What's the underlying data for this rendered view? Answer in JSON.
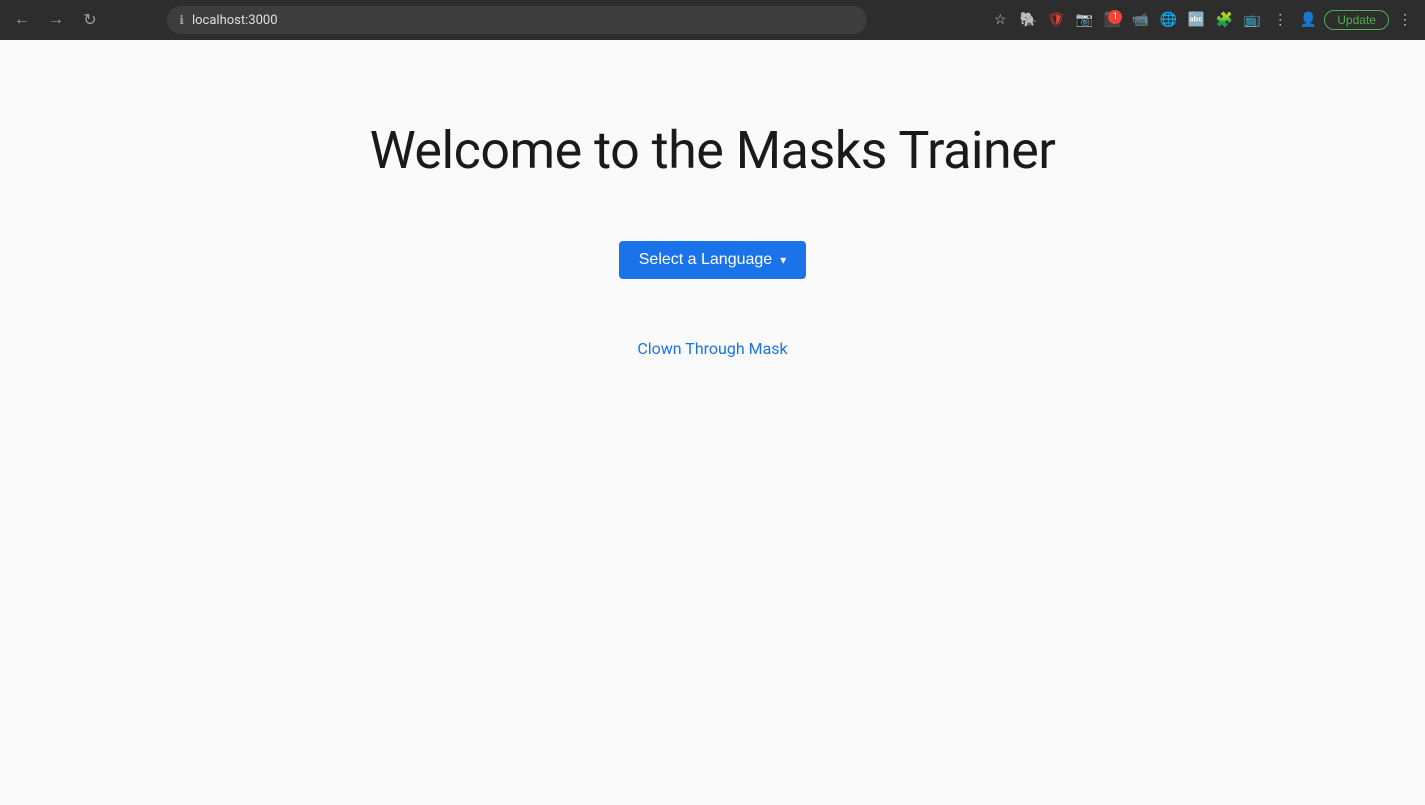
{
  "browser": {
    "url": "localhost:3000",
    "update_label": "Update"
  },
  "page": {
    "title": "Welcome to the Masks Trainer",
    "select_language_label": "Select a Language",
    "clown_link_label": "Clown Through Mask"
  },
  "toolbar": {
    "icons": [
      {
        "name": "bookmark-icon",
        "symbol": "☆"
      },
      {
        "name": "evernote-icon",
        "symbol": "🐘"
      },
      {
        "name": "privacy-icon",
        "symbol": "🛡"
      },
      {
        "name": "camera-icon",
        "symbol": "📷"
      },
      {
        "name": "extensions-icon",
        "symbol": "⬛"
      },
      {
        "name": "meet-icon",
        "symbol": "📹"
      },
      {
        "name": "profile-icon",
        "symbol": "👤"
      }
    ]
  }
}
